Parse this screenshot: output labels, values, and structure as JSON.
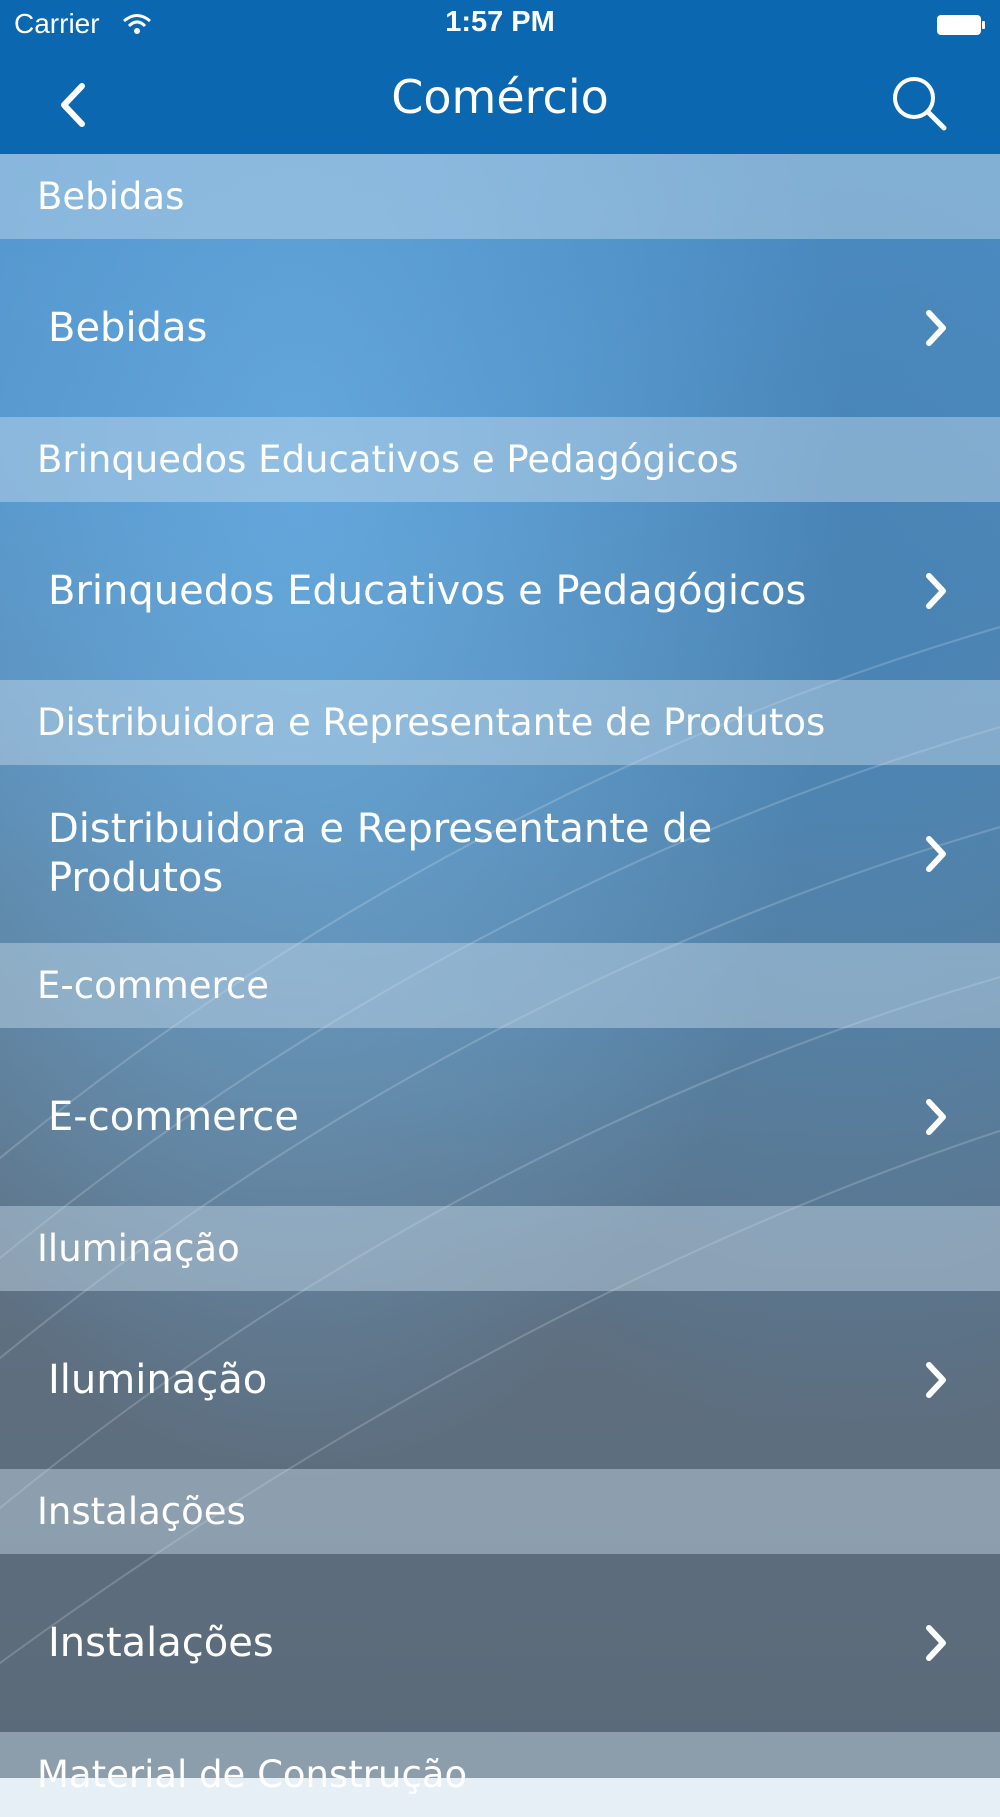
{
  "status_bar": {
    "carrier": "Carrier",
    "time": "1:57 PM"
  },
  "nav": {
    "title": "Comércio"
  },
  "icons": {
    "back": "chevron-left-icon",
    "search": "search-icon",
    "row_arrow": "chevron-right-icon"
  },
  "colors": {
    "bar": "#0a67b0"
  },
  "sections": [
    {
      "header": "Bebidas",
      "item": "Bebidas"
    },
    {
      "header": "Brinquedos Educativos e Pedagógicos",
      "item": "Brinquedos Educativos e Pedagógicos"
    },
    {
      "header": "Distribuidora e Representante de Produtos",
      "item": "Distribuidora e Representante de Produtos"
    },
    {
      "header": "E-commerce",
      "item": "E-commerce"
    },
    {
      "header": "Iluminação",
      "item": "Iluminação"
    },
    {
      "header": "Instalações",
      "item": "Instalações"
    },
    {
      "header": "Material de Construção"
    }
  ]
}
